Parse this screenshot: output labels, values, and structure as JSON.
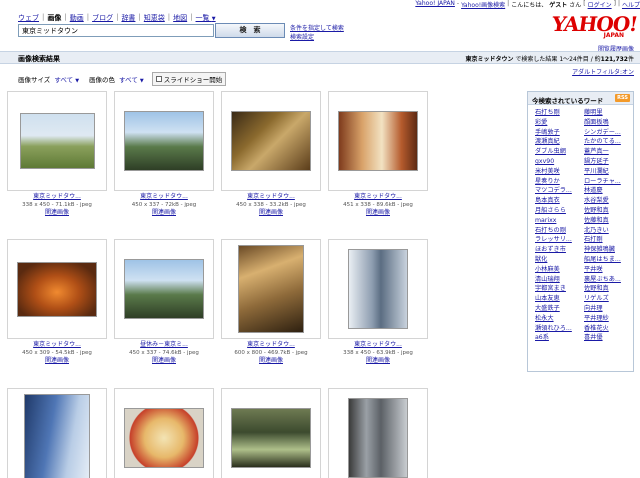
{
  "topbar": {
    "yahoo_japan": "Yahoo! JAPAN",
    "image_search": "Yahoo!画像検索",
    "greeting_prefix": "こんにちは、",
    "guest": "ゲスト",
    "greeting_suffix": "さん",
    "login": "ログイン",
    "help": "ヘルプ"
  },
  "tabs": [
    {
      "label": "ウェブ",
      "active": false
    },
    {
      "label": "画像",
      "active": true
    },
    {
      "label": "動画",
      "active": false
    },
    {
      "label": "ブログ",
      "active": false
    },
    {
      "label": "辞書",
      "active": false
    },
    {
      "label": "知恵袋",
      "active": false
    },
    {
      "label": "地図",
      "active": false
    }
  ],
  "tabs_more": "一覧",
  "search": {
    "value": "東京ミッドタウン",
    "button": "検　索",
    "advanced": "条件を指定して検索",
    "settings": "検索設定"
  },
  "logo": {
    "main": "YAHOO!",
    "sub": "JAPAN",
    "link": "閲覧履歴画像"
  },
  "result": {
    "title": "画像検索結果",
    "query": "東京ミッドタウン",
    "middle": "で検索した結果",
    "range": "1〜24件目",
    "total_prefix": "/ 約",
    "total": "121,732",
    "total_suffix": "件",
    "adult_filter": "アダルトフィルタ:オン"
  },
  "filters": {
    "size_label": "画像サイズ",
    "size_value": "すべて",
    "color_label": "画像の色",
    "color_value": "すべて",
    "slideshow": "スライドショー開始"
  },
  "images": [
    {
      "title": "東京ミッドタウ...",
      "meta": "338 x 450 - 71.1kB - jpeg",
      "find": "関連画像",
      "pic": "p1"
    },
    {
      "title": "東京ミッドタウ...",
      "meta": "450 x 337 - 72kB - jpeg",
      "find": "関連画像",
      "pic": "p5"
    },
    {
      "title": "東京ミッドタウ...",
      "meta": "450 x 338 - 33.2kB - jpeg",
      "find": "関連画像",
      "pic": "p2"
    },
    {
      "title": "東京ミッドタウ...",
      "meta": "451 x 338 - 89.6kB - jpeg",
      "find": "関連画像",
      "pic": "p3"
    },
    {
      "title": "東京ミッドタウ...",
      "meta": "450 x 309 - 54.5kB - jpeg",
      "find": "関連画像",
      "pic": "p4"
    },
    {
      "title": "昼休み－東京ミ...",
      "meta": "450 x 337 - 74.6kB - jpeg",
      "find": "関連画像",
      "pic": "p5"
    },
    {
      "title": "東京ミッドタウ...",
      "meta": "600 x 800 - 469.7kB - jpeg",
      "find": "関連画像",
      "pic": "p6"
    },
    {
      "title": "東京ミッドタウ...",
      "meta": "338 x 450 - 63.9kB - jpeg",
      "find": "関連画像",
      "pic": "p7"
    },
    {
      "title": "",
      "meta": "",
      "find": "",
      "pic": "p8"
    },
    {
      "title": "",
      "meta": "",
      "find": "",
      "pic": "p9"
    },
    {
      "title": "",
      "meta": "",
      "find": "",
      "pic": "p10"
    },
    {
      "title": "",
      "meta": "",
      "find": "",
      "pic": "p11"
    }
  ],
  "sidebar": {
    "title": "今検索されているワード",
    "rss": "RSS",
    "col1": [
      "石打ち剛",
      "彩愛",
      "手嶋敦子",
      "渡瀬真紀",
      "ダブル虫網",
      "gxv90",
      "米村美咲",
      "星奏りか",
      "マツコデラ...",
      "島本真衣",
      "月船さらら",
      "marixx",
      "石打ちの剛",
      "ラレッサリ...",
      "ほおずき市",
      "獣化",
      "小林麻美",
      "清山瑞翔",
      "宇都宮まき",
      "山本友恵",
      "大盛鉄子",
      "松永大",
      "瀬領れひろ...",
      "a6系"
    ],
    "col2": [
      "藤明里",
      "顔面板鳴",
      "シンガデー...",
      "たかのてる...",
      "蓋芦真一",
      "鍋方延子",
      "平川瀾紀",
      "ローラチャ...",
      "林道慶",
      "水谷梨愛",
      "佐野和真",
      "佐藤和真",
      "北乃きい",
      "石打剛",
      "神保雑鳴臓",
      "船尾はちま...",
      "平井咲",
      "裏屋ぶちあ...",
      "佐野和真",
      "リゲルズ",
      "向井理",
      "平井理紗",
      "香椎花火",
      "喜井優"
    ]
  }
}
